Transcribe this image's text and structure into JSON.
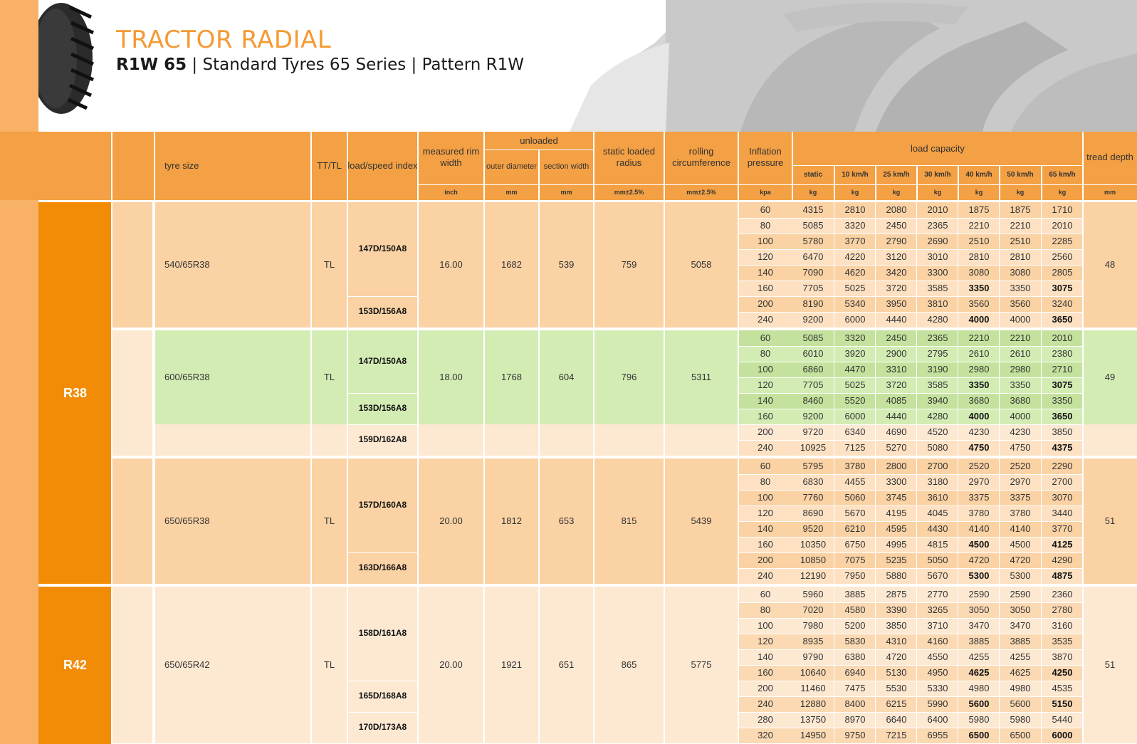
{
  "header": {
    "title": "TRACTOR RADIAL",
    "subtitle_bold": "R1W 65",
    "subtitle_rest": " | Standard Tyres 65 Series | Pattern R1W"
  },
  "colors": {
    "orange_header": "#f4a044",
    "rim_group": "#f28c06",
    "light_peach": "#fde8d2",
    "peach": "#fad2a4",
    "green_band": "#d3ecb4",
    "title_orange": "#f49a33"
  },
  "columns": {
    "tyre_size": "tyre size",
    "tt_tl": "TT/TL",
    "load_speed_index": "load/speed index",
    "measured_rim_width": "measured rim width",
    "unloaded": "unloaded",
    "outer_diameter": "outer diameter",
    "section_width": "section width",
    "static_loaded_radius": "static loaded radius",
    "rolling_circumference": "rolling circumference",
    "inflation_pressure": "Inflation pressure",
    "load_capacity": "load capacity",
    "tread_depth": "tread depth",
    "load_sub": [
      "static",
      "10 km/h",
      "25 km/h",
      "30 km/h",
      "40 km/h",
      "50 km/h",
      "65 km/h"
    ]
  },
  "units": {
    "rim": "inch",
    "outer": "mm",
    "section": "mm",
    "radius": "mm±2.5%",
    "circ": "mm±2.5%",
    "pressure": "kpa",
    "load": "kg",
    "tread": "mm"
  },
  "rim_groups": [
    "R38",
    "R42"
  ],
  "tyres": [
    {
      "size": "540/65R38",
      "tt": "TL",
      "rim": "16.00",
      "outer": "1682",
      "section": "539",
      "radius": "759",
      "circ": "5058",
      "tread": "48",
      "indices": [
        "147D/150A8",
        "153D/156A8"
      ],
      "rows": [
        [
          "60",
          "4315",
          "2810",
          "2080",
          "2010",
          "1875",
          "1875",
          "1710"
        ],
        [
          "80",
          "5085",
          "3320",
          "2450",
          "2365",
          "2210",
          "2210",
          "2010"
        ],
        [
          "100",
          "5780",
          "3770",
          "2790",
          "2690",
          "2510",
          "2510",
          "2285"
        ],
        [
          "120",
          "6470",
          "4220",
          "3120",
          "3010",
          "2810",
          "2810",
          "2560"
        ],
        [
          "140",
          "7090",
          "4620",
          "3420",
          "3300",
          "3080",
          "3080",
          "2805"
        ],
        [
          "160",
          "7705",
          "5025",
          "3720",
          "3585",
          "3350",
          "3350",
          "3075"
        ],
        [
          "200",
          "8190",
          "5340",
          "3950",
          "3810",
          "3560",
          "3560",
          "3240"
        ],
        [
          "240",
          "9200",
          "6000",
          "4440",
          "4280",
          "4000",
          "4000",
          "3650"
        ]
      ]
    },
    {
      "size": "600/65R38",
      "tt": "TL",
      "rim": "18.00",
      "outer": "1768",
      "section": "604",
      "radius": "796",
      "circ": "5311",
      "tread": "49",
      "indices": [
        "147D/150A8",
        "153D/156A8",
        "159D/162A8"
      ],
      "rows": [
        [
          "60",
          "5085",
          "3320",
          "2450",
          "2365",
          "2210",
          "2210",
          "2010"
        ],
        [
          "80",
          "6010",
          "3920",
          "2900",
          "2795",
          "2610",
          "2610",
          "2380"
        ],
        [
          "100",
          "6860",
          "4470",
          "3310",
          "3190",
          "2980",
          "2980",
          "2710"
        ],
        [
          "120",
          "7705",
          "5025",
          "3720",
          "3585",
          "3350",
          "3350",
          "3075"
        ],
        [
          "140",
          "8460",
          "5520",
          "4085",
          "3940",
          "3680",
          "3680",
          "3350"
        ],
        [
          "160",
          "9200",
          "6000",
          "4440",
          "4280",
          "4000",
          "4000",
          "3650"
        ],
        [
          "200",
          "9720",
          "6340",
          "4690",
          "4520",
          "4230",
          "4230",
          "3850"
        ],
        [
          "240",
          "10925",
          "7125",
          "5270",
          "5080",
          "4750",
          "4750",
          "4375"
        ]
      ]
    },
    {
      "size": "650/65R38",
      "tt": "TL",
      "rim": "20.00",
      "outer": "1812",
      "section": "653",
      "radius": "815",
      "circ": "5439",
      "tread": "51",
      "indices": [
        "157D/160A8",
        "163D/166A8"
      ],
      "rows": [
        [
          "60",
          "5795",
          "3780",
          "2800",
          "2700",
          "2520",
          "2520",
          "2290"
        ],
        [
          "80",
          "6830",
          "4455",
          "3300",
          "3180",
          "2970",
          "2970",
          "2700"
        ],
        [
          "100",
          "7760",
          "5060",
          "3745",
          "3610",
          "3375",
          "3375",
          "3070"
        ],
        [
          "120",
          "8690",
          "5670",
          "4195",
          "4045",
          "3780",
          "3780",
          "3440"
        ],
        [
          "140",
          "9520",
          "6210",
          "4595",
          "4430",
          "4140",
          "4140",
          "3770"
        ],
        [
          "160",
          "10350",
          "6750",
          "4995",
          "4815",
          "4500",
          "4500",
          "4125"
        ],
        [
          "200",
          "10850",
          "7075",
          "5235",
          "5050",
          "4720",
          "4720",
          "4290"
        ],
        [
          "240",
          "12190",
          "7950",
          "5880",
          "5670",
          "5300",
          "5300",
          "4875"
        ]
      ]
    },
    {
      "size": "650/65R42",
      "tt": "TL",
      "rim": "20.00",
      "outer": "1921",
      "section": "651",
      "radius": "865",
      "circ": "5775",
      "tread": "51",
      "indices": [
        "158D/161A8",
        "165D/168A8",
        "170D/173A8"
      ],
      "rows": [
        [
          "60",
          "5960",
          "3885",
          "2875",
          "2770",
          "2590",
          "2590",
          "2360"
        ],
        [
          "80",
          "7020",
          "4580",
          "3390",
          "3265",
          "3050",
          "3050",
          "2780"
        ],
        [
          "100",
          "7980",
          "5200",
          "3850",
          "3710",
          "3470",
          "3470",
          "3160"
        ],
        [
          "120",
          "8935",
          "5830",
          "4310",
          "4160",
          "3885",
          "3885",
          "3535"
        ],
        [
          "140",
          "9790",
          "6380",
          "4720",
          "4550",
          "4255",
          "4255",
          "3870"
        ],
        [
          "160",
          "10640",
          "6940",
          "5130",
          "4950",
          "4625",
          "4625",
          "4250"
        ],
        [
          "200",
          "11460",
          "7475",
          "5530",
          "5330",
          "4980",
          "4980",
          "4535"
        ],
        [
          "240",
          "12880",
          "8400",
          "6215",
          "5990",
          "5600",
          "5600",
          "5150"
        ],
        [
          "280",
          "13750",
          "8970",
          "6640",
          "6400",
          "5980",
          "5980",
          "5440"
        ],
        [
          "320",
          "14950",
          "9750",
          "7215",
          "6955",
          "6500",
          "6500",
          "6000"
        ]
      ]
    }
  ]
}
